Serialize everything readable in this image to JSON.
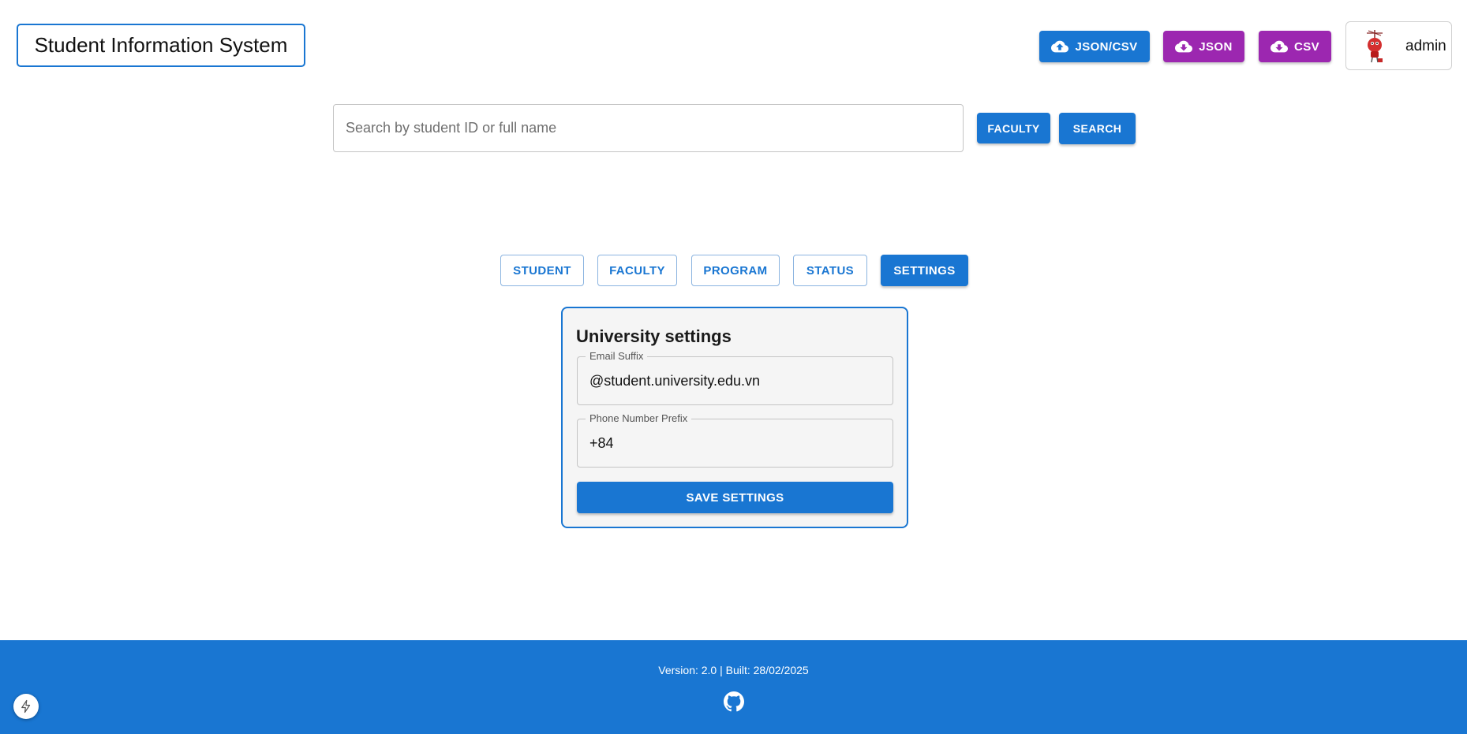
{
  "header": {
    "title": "Student Information System",
    "buttons": {
      "json_csv": "JSON/CSV",
      "json": "JSON",
      "csv": "CSV"
    },
    "user": {
      "name": "admin"
    }
  },
  "search": {
    "placeholder": "Search by student ID or full name",
    "value": "",
    "faculty_label": "FACULTY",
    "search_label": "SEARCH"
  },
  "tabs": [
    {
      "label": "STUDENT",
      "active": false
    },
    {
      "label": "FACULTY",
      "active": false
    },
    {
      "label": "PROGRAM",
      "active": false
    },
    {
      "label": "STATUS",
      "active": false
    },
    {
      "label": "SETTINGS",
      "active": true
    }
  ],
  "settings": {
    "title": "University settings",
    "email_suffix": {
      "label": "Email Suffix",
      "value": "@student.university.edu.vn"
    },
    "phone_prefix": {
      "label": "Phone Number Prefix",
      "value": "+84"
    },
    "save_label": "SAVE SETTINGS"
  },
  "footer": {
    "version_text": "Version: 2.0 | Built: 28/02/2025",
    "icon": "github-icon"
  },
  "colors": {
    "primary": "#1976d2",
    "secondary": "#9c27b0",
    "card_background": "#f5f5f5"
  }
}
